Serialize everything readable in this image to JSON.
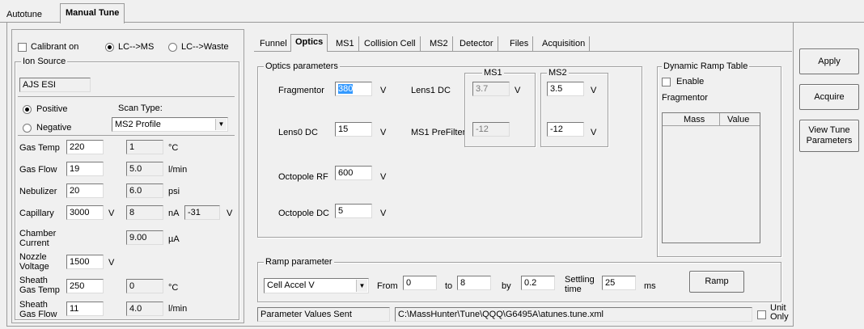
{
  "top_tabs": [
    {
      "label": "Autotune"
    },
    {
      "label": "Manual Tune"
    }
  ],
  "left": {
    "calibrant_label": "Calibrant on",
    "lc_ms_label": "LC-->MS",
    "lc_waste_label": "LC-->Waste",
    "ion_source_title": "Ion Source",
    "ion_source_value": "AJS ESI",
    "positive_label": "Positive",
    "negative_label": "Negative",
    "scan_type_label": "Scan Type:",
    "scan_type_value": "MS2 Profile",
    "rows": [
      {
        "label": "Gas Temp",
        "setpoint": "220",
        "actual": "1",
        "unit": "°C"
      },
      {
        "label": "Gas Flow",
        "setpoint": "19",
        "actual": "5.0",
        "unit": "l/min"
      },
      {
        "label": "Nebulizer",
        "setpoint": "20",
        "actual": "6.0",
        "unit": "psi"
      },
      {
        "label": "Capillary",
        "setpoint": "3000",
        "setpoint_unit": "V",
        "actual": "8",
        "unit": "nA",
        "extra": "-31",
        "extra_unit": "V"
      }
    ],
    "chamber_label": "Chamber Current",
    "chamber_actual": "9.00",
    "chamber_unit": "µA",
    "nozzle_label": "Nozzle Voltage",
    "nozzle_setpoint": "1500",
    "nozzle_unit": "V",
    "sheath_temp_label": "Sheath Gas Temp",
    "sheath_temp_setpoint": "250",
    "sheath_temp_actual": "0",
    "sheath_temp_unit": "°C",
    "sheath_flow_label": "Sheath Gas Flow",
    "sheath_flow_setpoint": "11",
    "sheath_flow_actual": "4.0",
    "sheath_flow_unit": "l/min"
  },
  "subtabs": [
    "Funnel",
    "Optics",
    "MS1",
    "Collision Cell",
    "MS2",
    "Detector",
    "Files",
    "Acquisition"
  ],
  "optics": {
    "group_title": "Optics parameters",
    "fragmentor_label": "Fragmentor",
    "fragmentor_value": "380",
    "lens0_label": "Lens0 DC",
    "lens0_value": "15",
    "octopole_rf_label": "Octopole RF",
    "octopole_rf_value": "600",
    "octopole_dc_label": "Octopole DC",
    "octopole_dc_value": "5",
    "v": "V",
    "lens1_label": "Lens1 DC",
    "prefilter_label": "MS1 PreFilter",
    "ms1_title": "MS1",
    "ms1_lens1": "3.7",
    "ms1_prefilter": "-12",
    "ms2_title": "MS2",
    "ms2_lens1": "3.5",
    "ms2_prefilter": "-12"
  },
  "ramp_table": {
    "title": "Dynamic Ramp Table",
    "enable_label": "Enable",
    "param_label": "Fragmentor",
    "col_mass": "Mass",
    "col_value": "Value"
  },
  "ramp": {
    "title": "Ramp parameter",
    "param_value": "Cell Accel V",
    "from_label": "From",
    "from_value": "0",
    "to_label": "to",
    "to_value": "8",
    "by_label": "by",
    "by_value": "0.2",
    "settling_label": "Settling time",
    "settling_value": "25",
    "ms_label": "ms",
    "button_label": "Ramp"
  },
  "status": {
    "message": "Parameter Values Sent",
    "path": "C:\\MassHunter\\Tune\\QQQ\\G6495A\\atunes.tune.xml",
    "unit_only_label": "Unit Only"
  },
  "buttons": {
    "apply": "Apply",
    "acquire": "Acquire",
    "view_tune": "View Tune Parameters"
  }
}
